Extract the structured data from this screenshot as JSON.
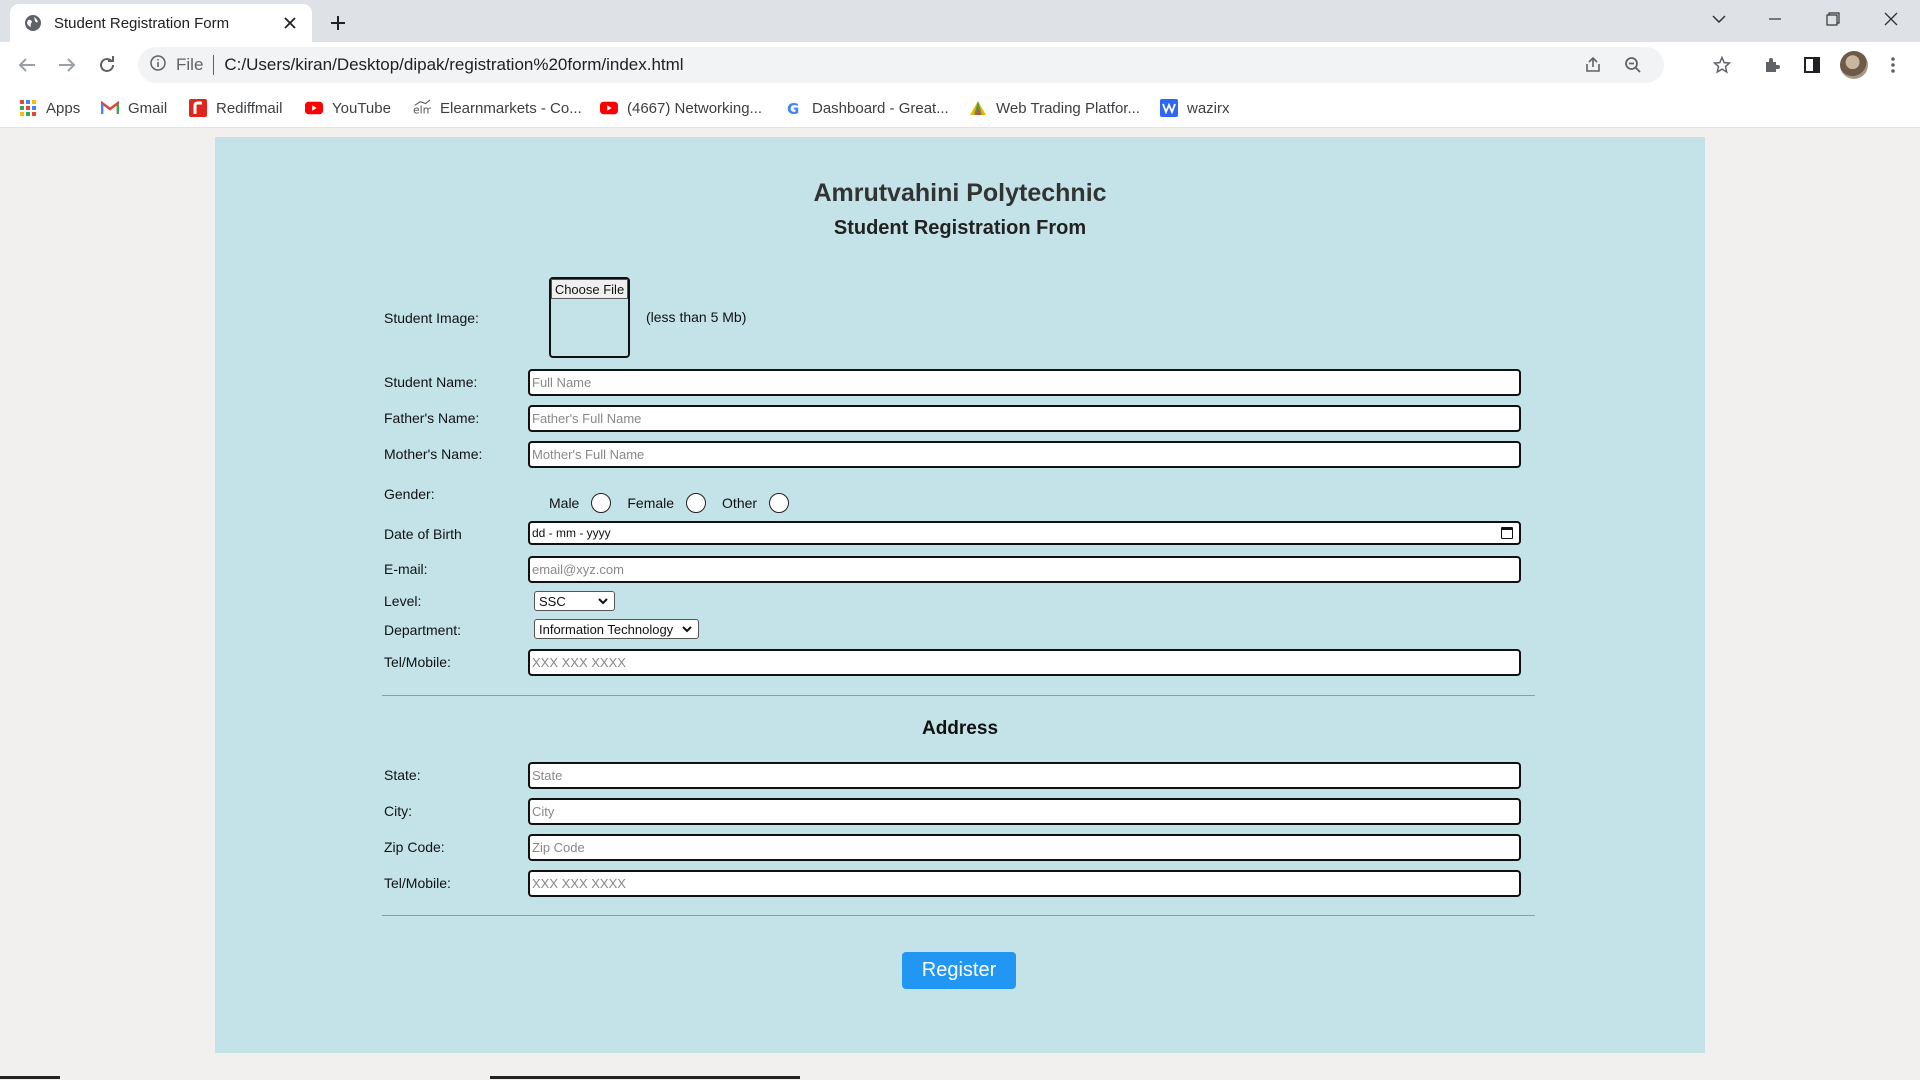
{
  "browser": {
    "tab_title": "Student Registration Form",
    "omnibox_file": "File",
    "url": "C:/Users/kiran/Desktop/dipak/registration%20form/index.html"
  },
  "bookmarks": [
    {
      "label": "Apps",
      "icon": "apps-grid-icon",
      "color": "#4285f4"
    },
    {
      "label": "Gmail",
      "icon": "gmail-icon",
      "color": "#ea4335"
    },
    {
      "label": "Rediffmail",
      "icon": "rediffmail-icon",
      "color": "#e1251b"
    },
    {
      "label": "YouTube",
      "icon": "youtube-icon",
      "color": "#ff0000"
    },
    {
      "label": "Elearnmarkets - Co...",
      "icon": "elearnmarkets-icon",
      "color": "#555555"
    },
    {
      "label": "(4667) Networking...",
      "icon": "youtube-icon",
      "color": "#ff0000"
    },
    {
      "label": "Dashboard - Great...",
      "icon": "google-icon",
      "color": "#4285f4"
    },
    {
      "label": "Web Trading Platfor...",
      "icon": "trading-icon",
      "color": "#f4b400"
    },
    {
      "label": "wazirx",
      "icon": "wazirx-icon",
      "color": "#3067f0"
    }
  ],
  "form": {
    "college": "Amrutvahini Polytechnic",
    "title": "Student Registration From",
    "student_image_label": "Student Image:",
    "choose_file": "Choose File",
    "file_note": "(less than 5 Mb)",
    "student_name": {
      "label": "Student Name:",
      "placeholder": "Full Name"
    },
    "father_name": {
      "label": "Father's Name:",
      "placeholder": "Father's Full Name"
    },
    "mother_name": {
      "label": "Mother's Name:",
      "placeholder": "Mother's Full Name"
    },
    "gender": {
      "label": "Gender:",
      "options": [
        "Male",
        "Female",
        "Other"
      ]
    },
    "dob": {
      "label": "Date of Birth",
      "value": "dd - mm - yyyy"
    },
    "email": {
      "label": "E-mail:",
      "placeholder": "email@xyz.com"
    },
    "level": {
      "label": "Level:",
      "selected": "SSC"
    },
    "department": {
      "label": "Department:",
      "selected": "Information Technology"
    },
    "tel": {
      "label": "Tel/Mobile:",
      "placeholder": "XXX XXX XXXX"
    }
  },
  "address": {
    "title": "Address",
    "state": {
      "label": "State:",
      "placeholder": "State"
    },
    "city": {
      "label": "City:",
      "placeholder": "City"
    },
    "zip": {
      "label": "Zip Code:",
      "placeholder": "Zip Code"
    },
    "tel": {
      "label": "Tel/Mobile:",
      "placeholder": "XXX XXX XXXX"
    }
  },
  "register_button": "Register",
  "colors": {
    "card_bg": "#c4e3e9",
    "register_bg": "#2196f3"
  }
}
